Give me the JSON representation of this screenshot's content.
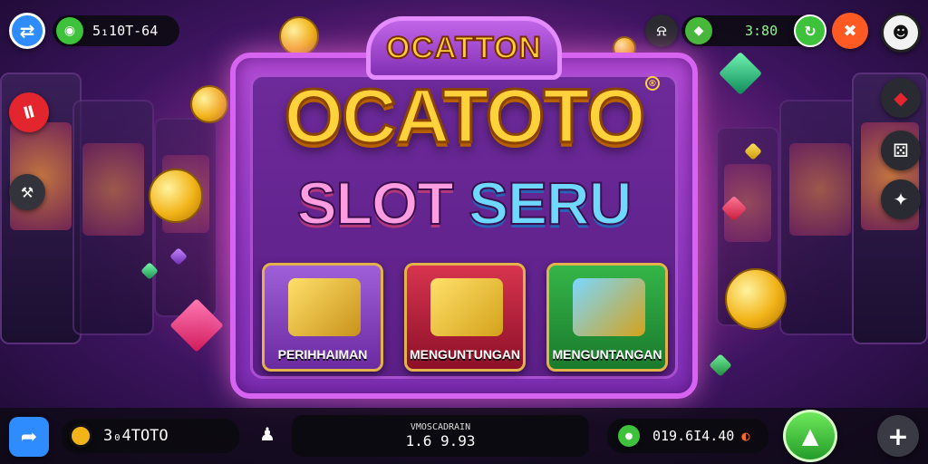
{
  "top_left": {
    "balance": "5₁10T-64"
  },
  "top_right": {
    "value": "3:80"
  },
  "panel": {
    "banner_text": "OCATTON",
    "title": "OCATOTO",
    "registered_mark": "®",
    "subtitle_word_1": "SLOT",
    "subtitle_word_2": "SERU"
  },
  "cards": [
    {
      "label": "PERIHHAIMAN"
    },
    {
      "label": "MENGUNTUNGAN"
    },
    {
      "label": "MENGUNTANGAN"
    }
  ],
  "bottom": {
    "coins_label": "3₀4TOTO",
    "center_top": "VMOSCADRAIN",
    "center_value": "1.6 9.93",
    "right_value": "019.6I4.40"
  },
  "icons": {
    "top_left_button": "swap-icon",
    "balance_icon": "coin-stack-icon",
    "alarm_icon": "bell-icon",
    "gem_icon": "gem-icon",
    "green_button_icon": "refresh-icon",
    "red_button_icon": "cross-icon",
    "avatar_icon": "avatar-icon",
    "left_side_red": "slot-icon",
    "left_side_tool": "hammer-icon",
    "right_side_1": "ruby-icon",
    "right_side_2": "dice-icon",
    "right_side_3": "star-icon",
    "bottom_left_arrow": "share-arrow-icon",
    "bottom_person": "player-icon",
    "bottom_coin": "coin-icon",
    "bottom_play": "play-icon",
    "bottom_plus": "plus-icon"
  },
  "colors": {
    "panel_border": "#d764f0",
    "title_gold": "#ffd23b",
    "accent_green": "#3ec23c",
    "accent_blue": "#2f8cff"
  }
}
